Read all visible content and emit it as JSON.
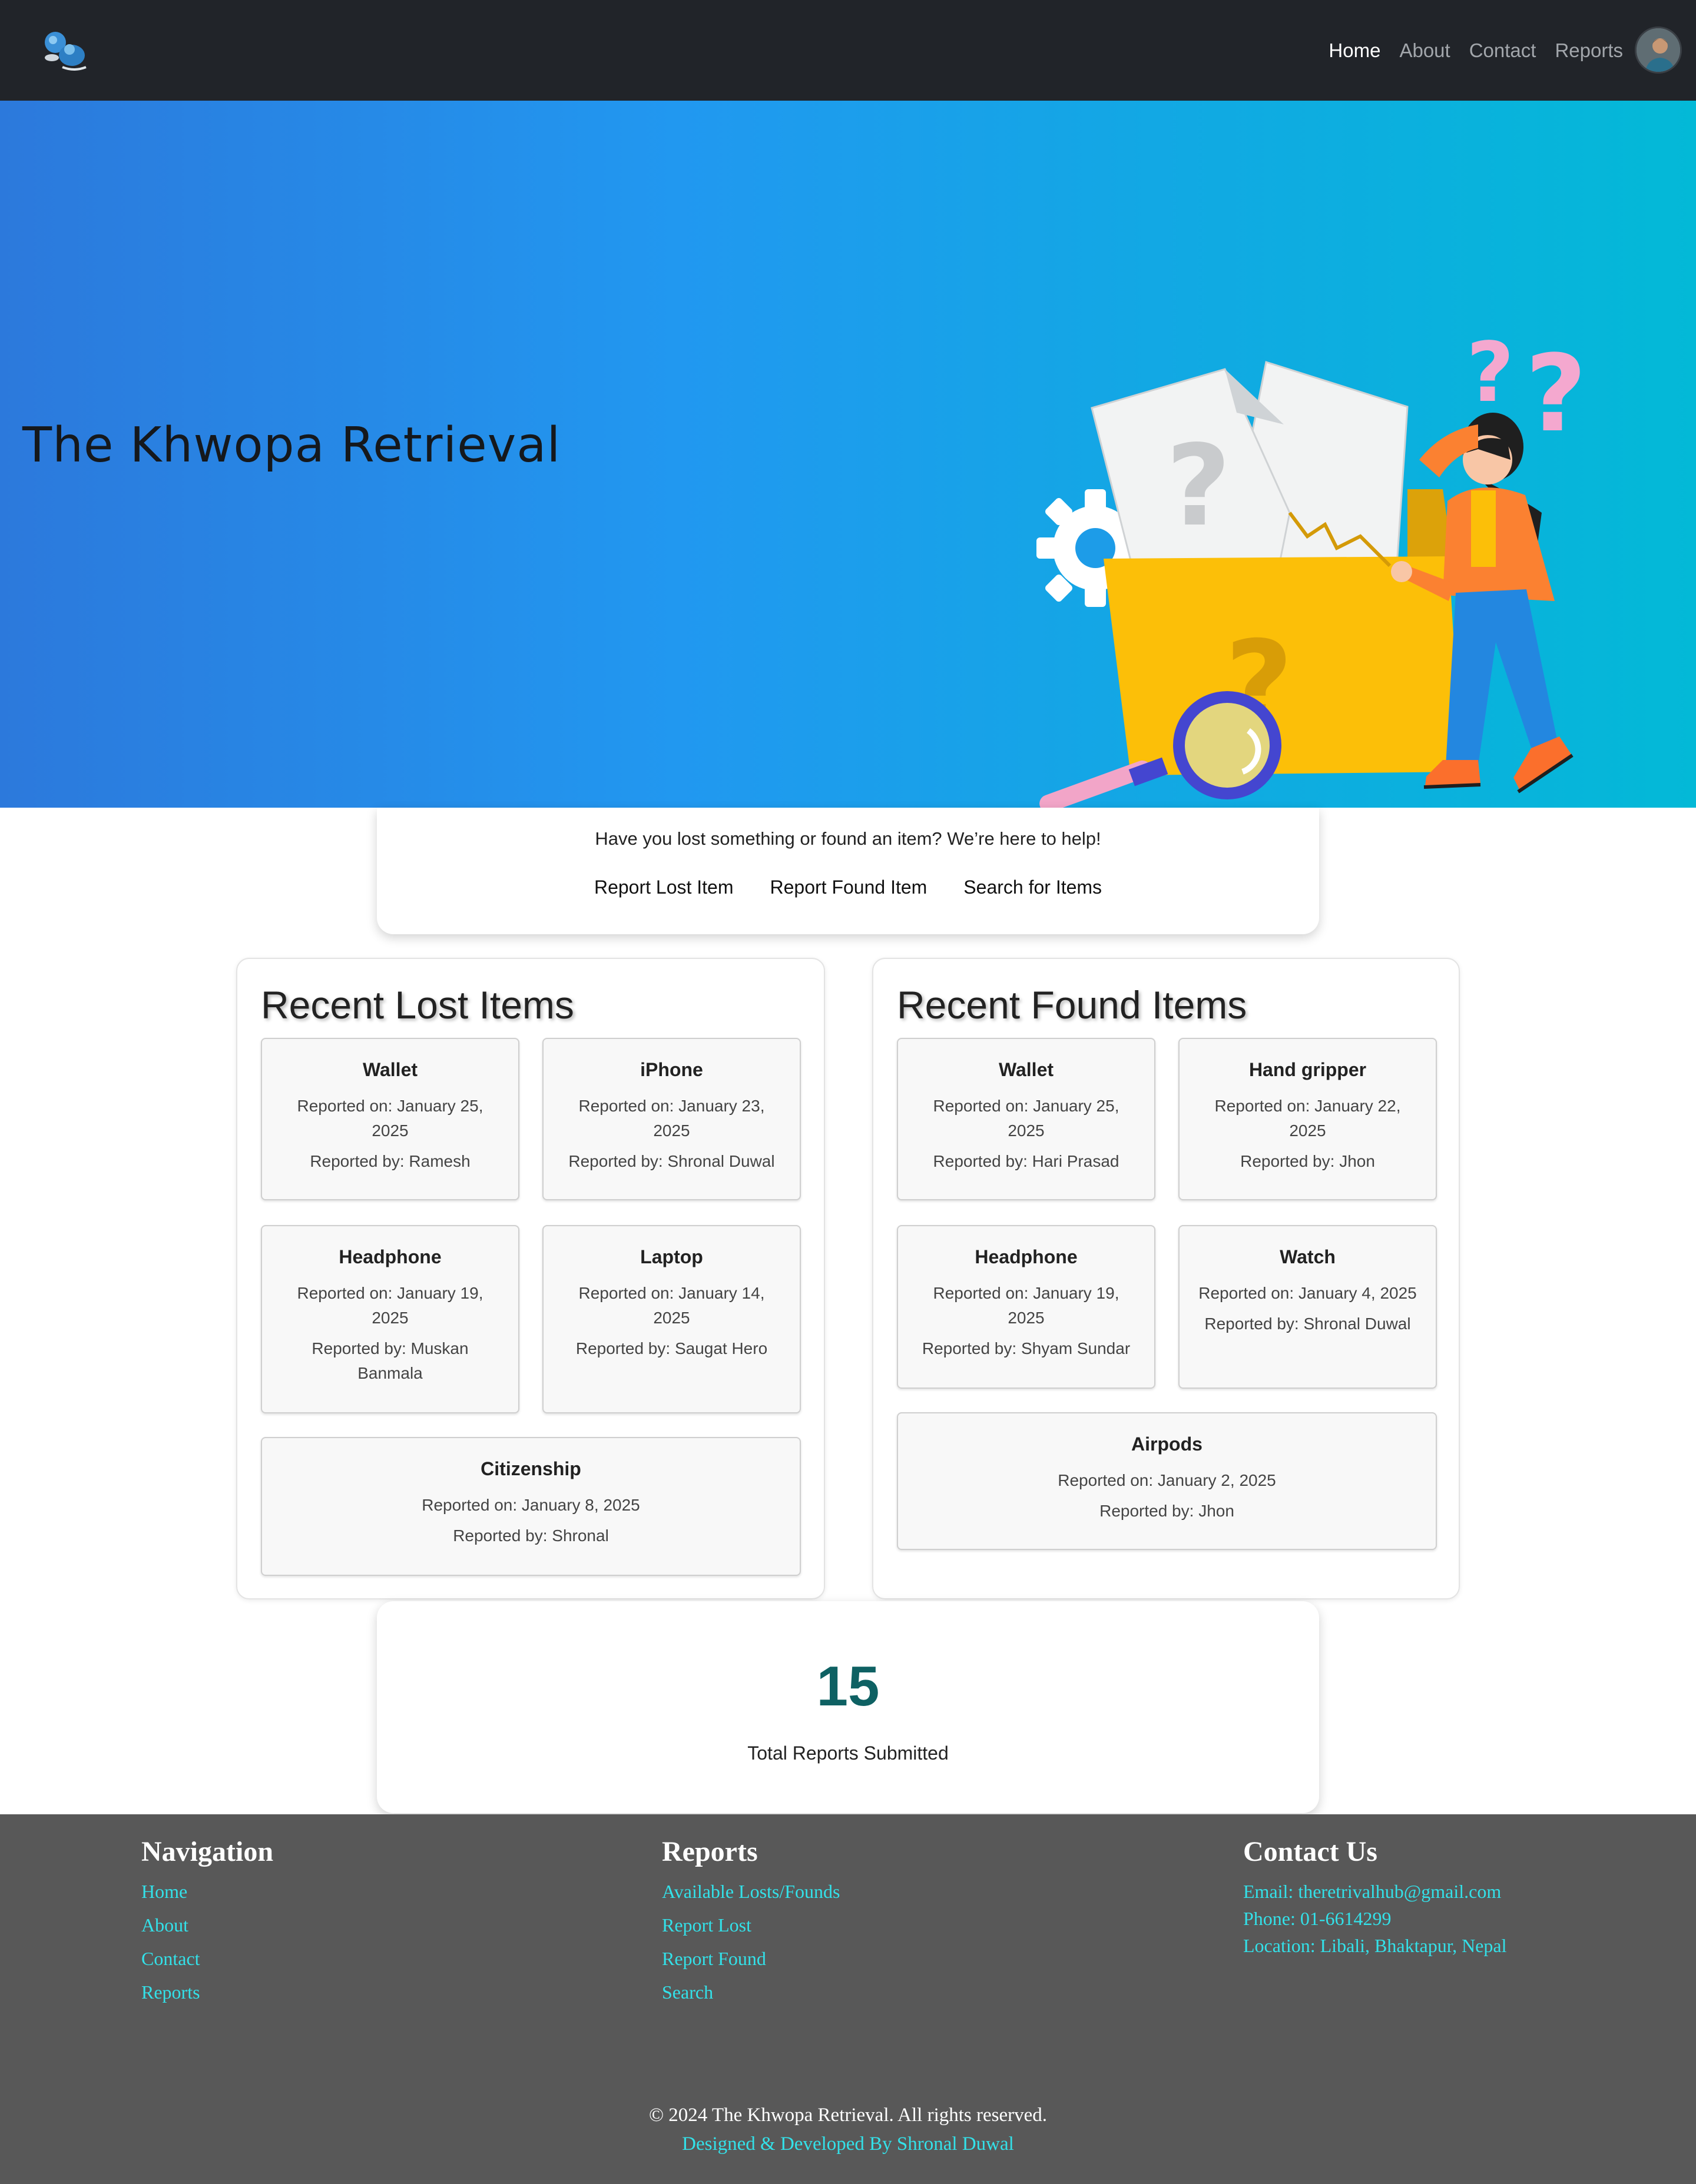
{
  "navbar": {
    "links": [
      "Home",
      "About",
      "Contact",
      "Reports"
    ],
    "active": "Home"
  },
  "hero": {
    "title": "The Khwopa Retrieval"
  },
  "help": {
    "text": "Have you lost something or found an item? We’re here to help!",
    "links": [
      "Report Lost Item",
      "Report Found Item",
      "Search for Items"
    ]
  },
  "lost": {
    "title": "Recent Lost Items",
    "items": [
      {
        "name": "Wallet",
        "date": "Reported on: January 25, 2025",
        "by": "Reported by: Ramesh"
      },
      {
        "name": "iPhone",
        "date": "Reported on: January 23, 2025",
        "by": "Reported by: Shronal Duwal"
      },
      {
        "name": "Headphone",
        "date": "Reported on: January 19, 2025",
        "by": "Reported by: Muskan Banmala"
      },
      {
        "name": "Laptop",
        "date": "Reported on: January 14, 2025",
        "by": "Reported by: Saugat Hero"
      },
      {
        "name": "Citizenship",
        "date": "Reported on: January 8, 2025",
        "by": "Reported by: Shronal"
      }
    ]
  },
  "found": {
    "title": "Recent Found Items",
    "items": [
      {
        "name": "Wallet",
        "date": "Reported on: January 25, 2025",
        "by": "Reported by: Hari Prasad"
      },
      {
        "name": "Hand gripper",
        "date": "Reported on: January 22, 2025",
        "by": "Reported by: Jhon"
      },
      {
        "name": "Headphone",
        "date": "Reported on: January 19, 2025",
        "by": "Reported by: Shyam Sundar"
      },
      {
        "name": "Watch",
        "date": "Reported on: January 4, 2025",
        "by": "Reported by: Shronal Duwal"
      },
      {
        "name": "Airpods",
        "date": "Reported on: January 2, 2025",
        "by": "Reported by: Jhon"
      }
    ]
  },
  "stats": {
    "total": "15",
    "label": "Total Reports Submitted"
  },
  "footer": {
    "nav_heading": "Navigation",
    "nav_links": [
      "Home",
      "About",
      "Contact",
      "Reports"
    ],
    "reports_heading": "Reports",
    "reports_links": [
      "Available Losts/Founds",
      "Report Lost",
      "Report Found",
      "Search"
    ],
    "contact_heading": "Contact Us",
    "email": "Email: theretrivalhub@gmail.com",
    "phone": "Phone: 01-6614299",
    "location": "Location: Libali, Bhaktapur, Nepal",
    "copyright": "© 2024 The Khwopa Retrieval. All rights reserved.",
    "credit": "Designed & Developed By Shronal Duwal"
  },
  "colors": {
    "navbar_bg": "#212429",
    "hero_start": "#2c79dc",
    "hero_end": "#03b9d7",
    "stat_number": "#0e6163",
    "footer_bg": "#585858",
    "footer_link": "#33e1e9"
  },
  "icons": [
    "site-logo-icon",
    "user-avatar-icon",
    "hero-illustration"
  ]
}
